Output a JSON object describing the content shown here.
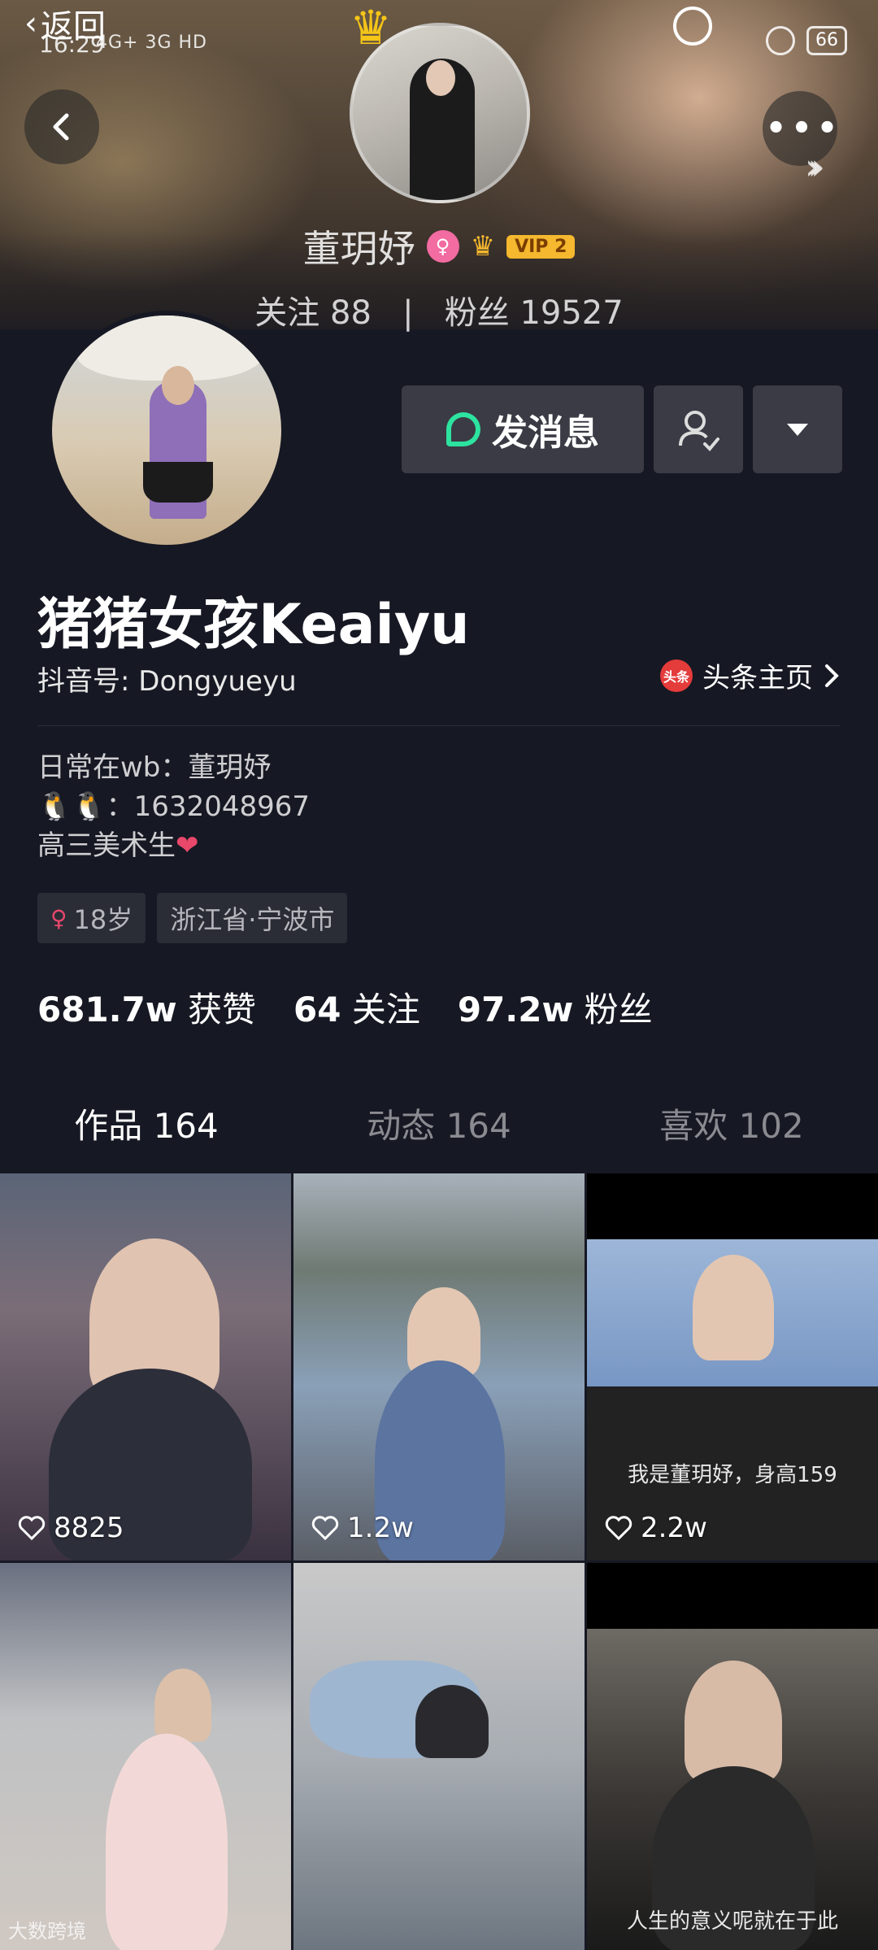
{
  "status": {
    "time": "16:29",
    "signal": "4G+ 3G HD",
    "battery": "66"
  },
  "overlay": {
    "back_label": "返回"
  },
  "banner": {
    "name": "董玥妤",
    "vip": "VIP 2",
    "following_label": "关注",
    "following": "88",
    "separator": "|",
    "fans_label": "粉丝",
    "fans": "19527"
  },
  "actions": {
    "message": "发消息"
  },
  "profile": {
    "nickname": "猪猪女孩Keaiyu",
    "douyin_id": "抖音号: Dongyueyu",
    "toutiao_label": "头条主页",
    "toutiao_icon_text": "头条",
    "bio": [
      "日常在wb：董玥妤",
      "🐧🐧：1632048967",
      "高三美术生"
    ],
    "tags": [
      "18岁",
      "浙江省·宁波市"
    ],
    "stats": [
      {
        "value": "681.7w",
        "label": "获赞"
      },
      {
        "value": "64",
        "label": "关注"
      },
      {
        "value": "97.2w",
        "label": "粉丝"
      }
    ]
  },
  "tabs": [
    "作品 164",
    "动态 164",
    "喜欢 102"
  ],
  "videos": [
    {
      "likes": "8825",
      "caption": ""
    },
    {
      "likes": "1.2w",
      "caption": ""
    },
    {
      "likes": "2.2w",
      "caption": "我是董玥妤，身高159"
    },
    {
      "likes": "",
      "caption": ""
    },
    {
      "likes": "",
      "caption": ""
    },
    {
      "likes": "",
      "caption": "人生的意义呢就在于此"
    }
  ],
  "watermark": "大数跨境",
  "colors": {
    "accent_tab": "#f7c21d",
    "chat_icon": "#2de3a0",
    "background": "#161823"
  }
}
